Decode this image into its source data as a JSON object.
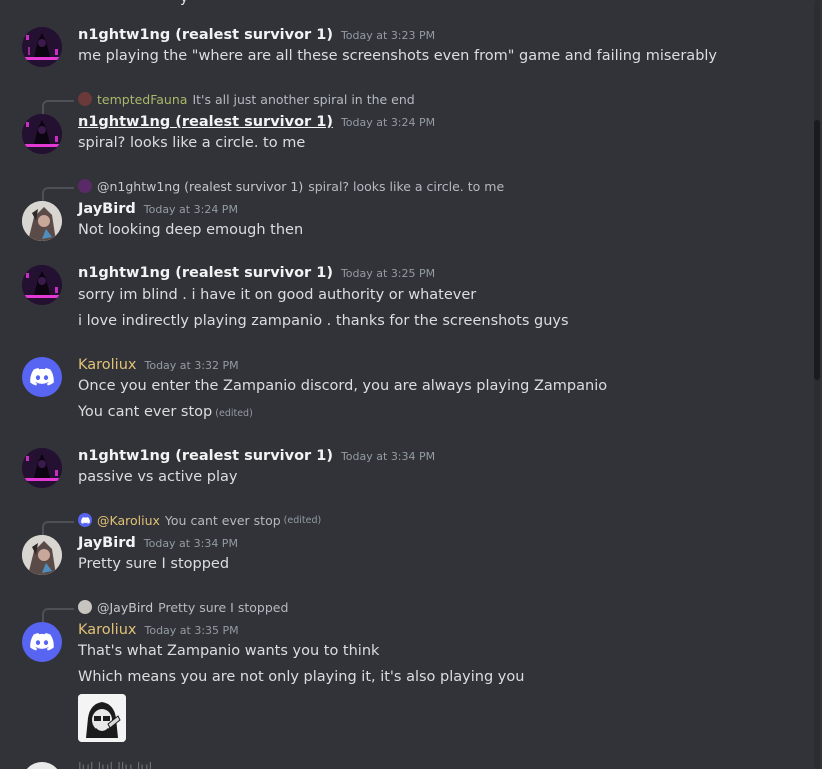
{
  "top_cut_text": "y",
  "messages": [
    {
      "id": "m1",
      "author": "n1ghtw1ng (realest survivor 1)",
      "timestamp": "Today at 3:23 PM",
      "lines": [
        "me playing the \"where are all these screenshots even from\" game and failing miserably"
      ]
    },
    {
      "id": "m2",
      "reply_to": {
        "name": "temptedFauna",
        "text": "It's all just another spiral in the end"
      },
      "author": "n1ghtw1ng (realest survivor 1)",
      "timestamp": "Today at 3:24 PM",
      "lines": [
        "spiral? looks like a circle. to me"
      ]
    },
    {
      "id": "m3",
      "reply_to": {
        "name": "@n1ghtw1ng (realest survivor 1)",
        "text": "spiral? looks like a circle. to me"
      },
      "author": "JayBird",
      "timestamp": "Today at 3:24 PM",
      "lines": [
        "Not looking deep emough then"
      ]
    },
    {
      "id": "m4",
      "author": "n1ghtw1ng (realest survivor 1)",
      "timestamp": "Today at 3:25 PM",
      "lines": [
        "sorry im blind . i have it on good authority or whatever",
        "i love indirectly playing zampanio . thanks for the screenshots guys"
      ]
    },
    {
      "id": "m5",
      "author": "Karoliux",
      "timestamp": "Today at 3:32 PM",
      "lines": [
        "Once you enter the Zampanio discord, you are always playing Zampanio",
        "You cant ever stop"
      ],
      "edited_label": "(edited)"
    },
    {
      "id": "m6",
      "author": "n1ghtw1ng (realest survivor 1)",
      "timestamp": "Today at 3:34 PM",
      "lines": [
        "passive vs active play"
      ]
    },
    {
      "id": "m7",
      "reply_to": {
        "name": "@Karoliux",
        "text": "You cant ever stop",
        "edited": "(edited)"
      },
      "author": "JayBird",
      "timestamp": "Today at 3:34 PM",
      "lines": [
        "Pretty sure I stopped"
      ]
    },
    {
      "id": "m8",
      "reply_to": {
        "name": "@JayBird",
        "text": "Pretty sure I stopped"
      },
      "author": "Karoliux",
      "timestamp": "Today at 3:35 PM",
      "lines": [
        "That's what Zampanio wants you to think",
        "Which means you are not only playing it, it's also playing you"
      ]
    }
  ],
  "bottom_cut_text": "lul lul llu lul",
  "colors": {
    "background": "#313338",
    "text": "#dbdee1",
    "username_default": "#f2f3f5",
    "username_karoliux": "#e1c175",
    "reply_name_fauna": "#a9b96b",
    "timestamp": "#949ba4",
    "discord_blurple": "#5865f2"
  }
}
